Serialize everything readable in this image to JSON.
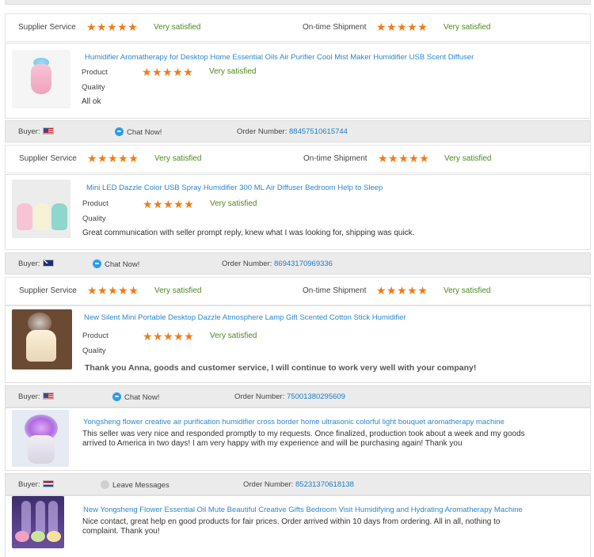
{
  "rating_labels": {
    "supplier_service": "Supplier Service",
    "on_time_shipment": "On-time Shipment",
    "product": "Product",
    "quality": "Quality",
    "very_satisfied": "Very satisfied",
    "stars": "★★★★★"
  },
  "chat_label": "Chat Now!",
  "leave_label": "Leave Messages",
  "buyer_label": "Buyer:",
  "order_label": "Order Number:",
  "reviews": [
    {
      "title": "Humidifier Aromatherapy for Desktop Home Essential Oils Air Purifier Cool Mist Maker Humidifier USB Scent Diffuser",
      "review": "All ok",
      "supplier_stars": 5,
      "shipment_stars": 5,
      "product_stars": 5
    },
    {
      "buyer_flag": "us-flag",
      "order_number": "88457510615744",
      "title": "Mini LED Dazzle Color USB Spray Humidifier 300 ML Air Diffuser Bedroom Help to Sleep",
      "review": "Great communication with seller prompt reply, knew what I was looking for, shipping was quick.",
      "supplier_stars": 5,
      "shipment_stars": 5,
      "product_stars": 5
    },
    {
      "buyer_flag": "au-flag",
      "order_number": "86943170969336",
      "title": "New Silent Mini Portable Desktop Dazzle Atmosphere Lamp Gift Scented Cotton Stick Humidifier",
      "review": "Thank you Anna, goods and customer service, I will continue to work very well with your company!",
      "supplier_stars": 5,
      "shipment_stars": 5,
      "product_stars": 5
    },
    {
      "buyer_flag": "us-flag",
      "order_number": "75001380295609",
      "title": "Yongsheng flower creative air purification humidifier cross border home ultrasonic colorful light bouquet aromatherapy machine",
      "review_line1": "This seller was very nice and responded promptly to my requests. Once finalized, production took about a week and my goods",
      "review_line2": "arrived to America in two days! I am very happy with my experience and will be purchasing again! Thank you"
    },
    {
      "buyer_flag": "nl-flag",
      "order_number": "85231370618138",
      "title": "New Yongsheng Flower Essential Oil Mute Beautiful Creative Gifts Bedroom Visit Humidifying and Hydrating Aromatherapy Machine",
      "review_line1": "Nice contact, great help en good products for fair prices. Order arrived within 10 days from ordering. All in all, nothing to",
      "review_line2": "complaint. Thank you!"
    }
  ],
  "colors": {
    "star": "#ef7b1a",
    "satisfied_text": "#4a8a1c",
    "link": "#2a87cc",
    "order_number": "#1a7cc8",
    "bar_bg": "#ebebeb"
  }
}
